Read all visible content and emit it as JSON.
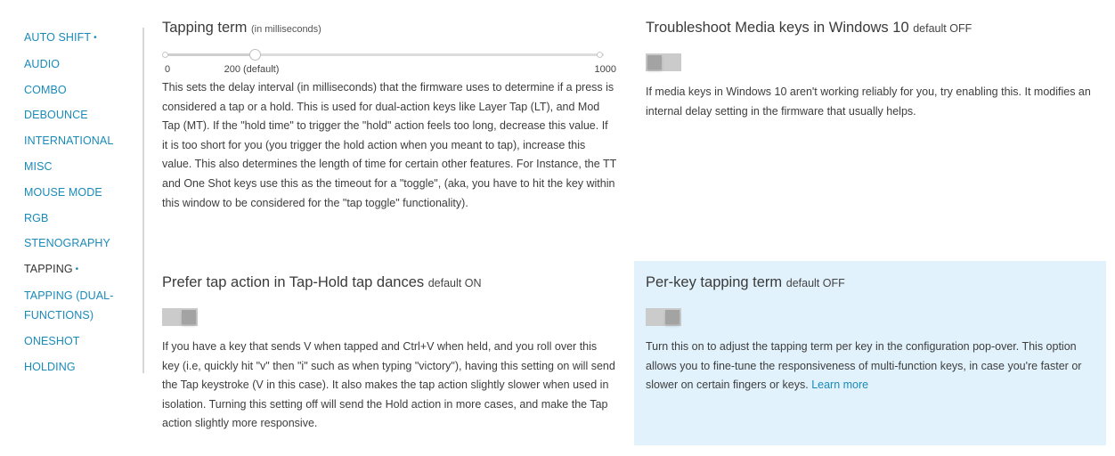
{
  "sidebar": {
    "items": [
      {
        "label": "AUTO SHIFT",
        "dot": "•",
        "active": false
      },
      {
        "label": "AUDIO"
      },
      {
        "label": "COMBO"
      },
      {
        "label": "DEBOUNCE"
      },
      {
        "label": "INTERNATIONAL"
      },
      {
        "label": "MISC"
      },
      {
        "label": "MOUSE MODE"
      },
      {
        "label": "RGB"
      },
      {
        "label": "STENOGRAPHY"
      },
      {
        "label": "TAPPING",
        "dot": "•",
        "active": true
      },
      {
        "label": "TAPPING (DUAL-FUNCTIONS)"
      },
      {
        "label": "ONESHOT"
      },
      {
        "label": "HOLDING"
      }
    ]
  },
  "tapping_term": {
    "title": "Tapping term",
    "hint": "(in milliseconds)",
    "slider": {
      "min": 0,
      "max": 1000,
      "value": 200,
      "default": 200
    },
    "labels": {
      "min": "0",
      "default": "200 (default)",
      "max": "1000"
    },
    "description": "This sets the delay interval (in milliseconds) that the firmware uses to determine if a press is considered a tap or a hold. This is used for dual-action keys like Layer Tap (LT), and Mod Tap (MT). If the \"hold time\" to trigger the \"hold\" action feels too long, decrease this value. If it is too short for you (you trigger the hold action when you meant to tap), increase this value. This also determines the length of time for certain other features. For Instance, the TT and One Shot keys use this as the timeout for a \"toggle\", (aka, you have to hit the key within this window to be considered for the \"tap toggle\" functionality)."
  },
  "troubleshoot": {
    "title": "Troubleshoot Media keys in Windows 10",
    "default_label": "default OFF",
    "state": "off",
    "description": "If media keys in Windows 10 aren't working reliably for you, try enabling this. It modifies an internal delay setting in the firmware that usually helps."
  },
  "prefer_tap": {
    "title": "Prefer tap action in Tap-Hold tap dances",
    "default_label": "default ON",
    "state": "on",
    "description": "If you have a key that sends V when tapped and Ctrl+V when held, and you roll over this key (i.e, quickly hit \"v\" then \"i\" such as when typing \"victory\"), having this setting on will send the Tap keystroke (V in this case). It also makes the tap action slightly slower when used in isolation. Turning this setting off will send the Hold action in more cases, and make the Tap action slightly more responsive."
  },
  "per_key": {
    "title": "Per-key tapping term",
    "default_label": "default OFF",
    "state": "on",
    "description": "Turn this on to adjust the tapping term per key in the configuration pop-over. This option allows you to fine-tune the responsiveness of multi-function keys, in case you're faster or slower on certain fingers or keys.",
    "link_label": "Learn more"
  },
  "colors": {
    "accent": "#1a8ab9",
    "highlight_bg": "#e1f2fc",
    "toggle_track": "#cbcbcb",
    "toggle_knob": "#a3a3a3"
  }
}
